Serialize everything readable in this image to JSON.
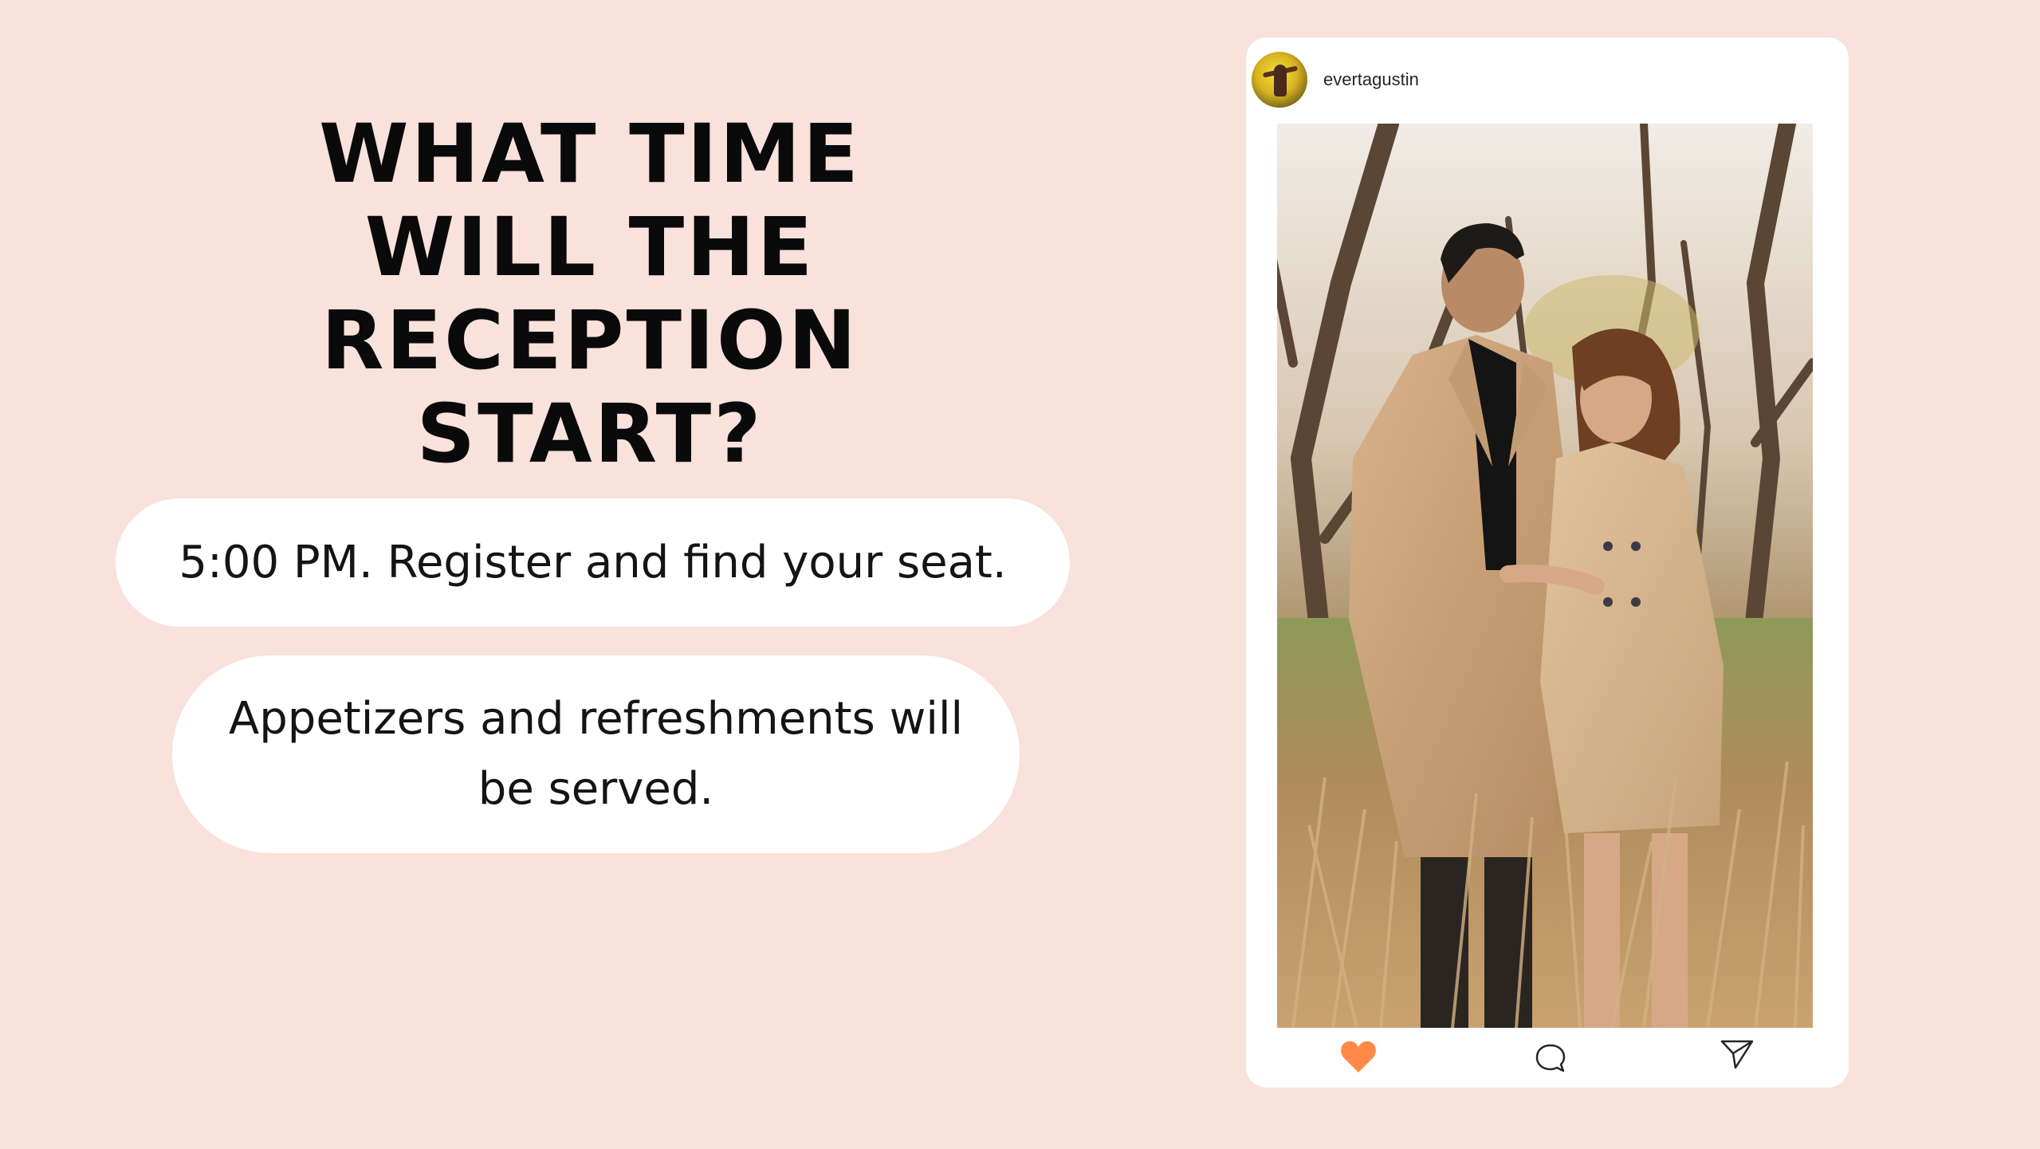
{
  "headline": {
    "line1": "WHAT TIME",
    "line2": "WILL THE RECEPTION",
    "line3": "START?"
  },
  "info": {
    "pill1": "5:00 PM. Register and find your seat.",
    "pill2": "Appetizers and refreshments will be served."
  },
  "post": {
    "username": "evertagustin",
    "actions": [
      {
        "icon": "heart-icon",
        "color": "#ff8a47"
      },
      {
        "icon": "comment-icon"
      },
      {
        "icon": "send-icon"
      }
    ]
  },
  "colors": {
    "background": "#f9e1dc",
    "card": "#ffffff",
    "heart": "#ff8a47",
    "text": "#0a0a0a"
  }
}
